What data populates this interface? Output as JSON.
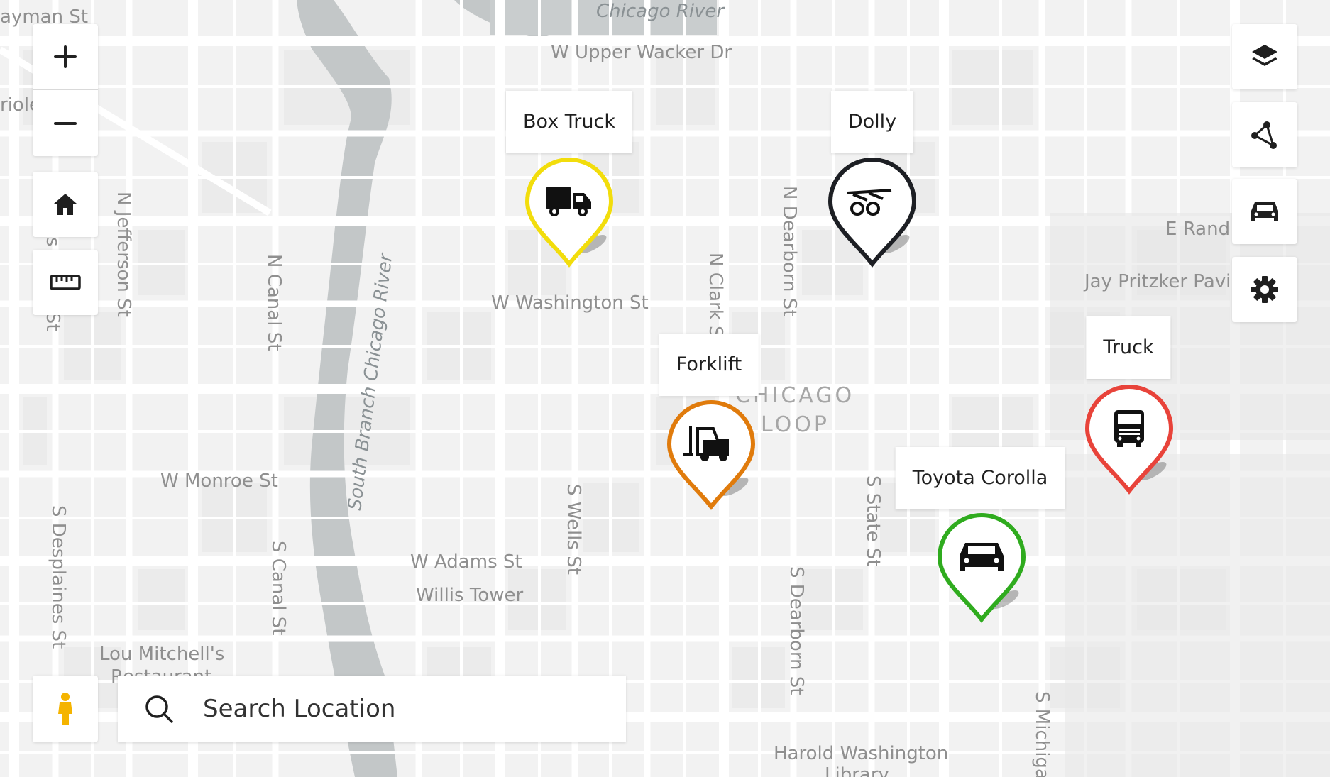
{
  "map": {
    "street_labels": [
      "ayman St",
      "Chicago River",
      "W Upper Wacker Dr",
      "riole",
      "N Jefferson St",
      "N Canal St",
      "South Branch Chicago River",
      "W Washington St",
      "N Clark St",
      "N Dearborn St",
      "E Rand",
      "Jay Pritzker Pavil",
      "CHICAGO",
      "LOOP",
      "W Monroe St",
      "S Wells St",
      "S State St",
      "W Adams St",
      "Willis Tower",
      "S Canal St",
      "S Dearborn St",
      "S Desplaines St",
      "Lou Mitchell's",
      "Restaurant",
      "S Michigan",
      "Harold Washington",
      "Library",
      "s",
      "s St"
    ]
  },
  "left_controls": {
    "zoom_in_icon": "plus-icon",
    "zoom_out_icon": "minus-icon",
    "home_icon": "home-icon",
    "measure_icon": "ruler-icon",
    "street_view_icon": "pegman-icon"
  },
  "right_controls": {
    "layers_icon": "layers-icon",
    "draw_icon": "polygon-icon",
    "vehicles_icon": "car-icon",
    "settings_icon": "gear-icon"
  },
  "markers": [
    {
      "label": "Box Truck",
      "icon": "box-truck-icon",
      "color": "#f2dd0c"
    },
    {
      "label": "Dolly",
      "icon": "dolly-icon",
      "color": "#1d1f24"
    },
    {
      "label": "Forklift",
      "icon": "forklift-icon",
      "color": "#e07b0c"
    },
    {
      "label": "Truck",
      "icon": "truck-front-icon",
      "color": "#e8433a"
    },
    {
      "label": "Toyota Corolla",
      "icon": "car-icon",
      "color": "#2fab1e"
    }
  ],
  "search": {
    "placeholder": "Search Location",
    "value": "",
    "icon": "search-icon"
  }
}
